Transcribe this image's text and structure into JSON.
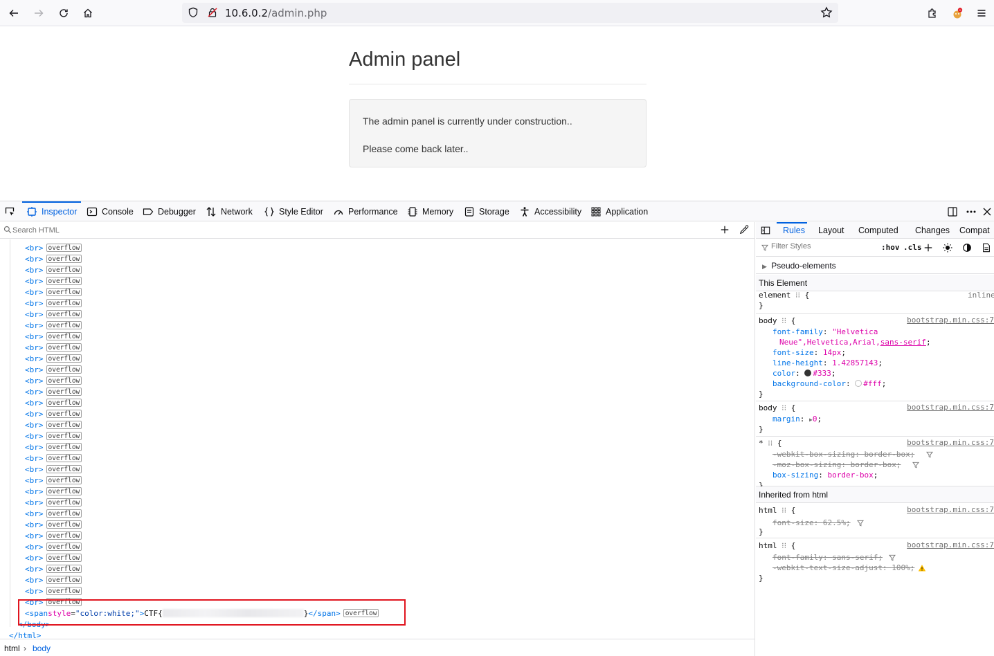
{
  "browser": {
    "url_host": "10.6.0.2",
    "url_path": "/admin.php"
  },
  "page": {
    "title": "Admin panel",
    "well_line1": "The admin panel is currently under construction..",
    "well_line2": "Please come back later.."
  },
  "devtools": {
    "tabs": [
      "Inspector",
      "Console",
      "Debugger",
      "Network",
      "Style Editor",
      "Performance",
      "Memory",
      "Storage",
      "Accessibility",
      "Application"
    ],
    "search_placeholder": "Search HTML",
    "markup": {
      "br_tag_open": "<",
      "br_tag_name": "br",
      "br_tag_close": ">",
      "overflow_badge": "overflow",
      "br_count": 33,
      "span_tag": "span",
      "span_attr_name": "style",
      "span_attr_value": "\"color:white;\"",
      "span_text_start": "CTF{",
      "span_text_end": "}",
      "body_close": "</body>",
      "html_close": "</html>"
    },
    "breadcrumbs": [
      "html",
      "body"
    ],
    "sidebar": {
      "tabs": [
        "Rules",
        "Layout",
        "Computed",
        "Changes",
        "Compat"
      ],
      "filter_placeholder": "Filter Styles",
      "hov": ":hov",
      "cls": ".cls",
      "pseudo_elements": "Pseudo-elements",
      "this_element": "This Element",
      "inherited_from_html": "Inherited from html",
      "source": "bootstrap.min.css:7",
      "element_rule": {
        "selector": "element",
        "display": "inline"
      },
      "body_rule1": {
        "selector": "body",
        "font_family_prop": "font-family",
        "font_family_val1": "\"Helvetica",
        "font_family_val2": "Neue\",Helvetica,Arial,",
        "font_family_val3": "sans-serif",
        "font_size_prop": "font-size",
        "font_size_val": "14px",
        "line_height_prop": "line-height",
        "line_height_val": "1.42857143",
        "color_prop": "color",
        "color_val": "#333",
        "bg_prop": "background-color",
        "bg_val": "#fff"
      },
      "body_rule2": {
        "selector": "body",
        "prop": "margin",
        "val": "0"
      },
      "star_rule": {
        "selector": "*",
        "p1": "-webkit-box-sizing",
        "v1": "border-box",
        "p2": "-moz-box-sizing",
        "v2": "border-box",
        "p3": "box-sizing",
        "v3": "border-box"
      },
      "html_rule1": {
        "selector": "html",
        "prop": "font-size",
        "val": "62.5%"
      },
      "html_rule2": {
        "selector": "html",
        "p1": "font-family",
        "v1": "sans-serif",
        "p2": "-webkit-text-size-adjust",
        "v2": "100%"
      }
    }
  }
}
